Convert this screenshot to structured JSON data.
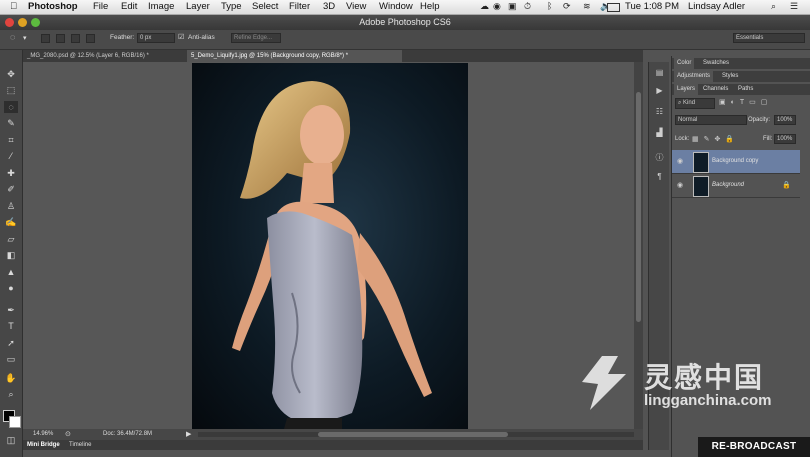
{
  "menubar": {
    "apple": "",
    "app": "Photoshop",
    "items": [
      "File",
      "Edit",
      "Image",
      "Layer",
      "Type",
      "Select",
      "Filter",
      "3D",
      "View",
      "Window",
      "Help"
    ],
    "clock": "Tue 1:08 PM",
    "user": "Lindsay Adler"
  },
  "window": {
    "title": "Adobe Photoshop CS6"
  },
  "options": {
    "feather_label": "Feather:",
    "feather_value": "0 px",
    "antialias_label": "Anti-alias",
    "refine_edge": "Refine Edge...",
    "workspace": "Essentials"
  },
  "doc_tabs": [
    {
      "label": "_MG_2080.psd @ 12.5% (Layer 6, RGB/16) *"
    },
    {
      "label": "5_Demo_Liquify1.jpg @ 15% (Background copy, RGB/8*) *"
    }
  ],
  "status": {
    "zoom": "14.96%",
    "doc": "Doc: 36.4M/72.8M"
  },
  "bottom_tabs": [
    "Mini Bridge",
    "Timeline"
  ],
  "panels": {
    "color_tabs": [
      "Color",
      "Swatches"
    ],
    "adj_tabs": [
      "Adjustments",
      "Styles"
    ],
    "layer_tabs": [
      "Layers",
      "Channels",
      "Paths"
    ],
    "kind": "Kind",
    "blend_mode": "Normal",
    "opacity_label": "Opacity:",
    "opacity_value": "100%",
    "lock_label": "Lock:",
    "fill_label": "Fill:",
    "fill_value": "100%",
    "layers": [
      {
        "name": "Background copy"
      },
      {
        "name": "Background"
      }
    ]
  },
  "overlay": {
    "broadcast": "RE-BROADCAST",
    "watermark_cn": "灵感中国",
    "watermark_url": "lingganchina.com"
  },
  "colors": {
    "accent_selected_layer": "#6b7fa3"
  }
}
